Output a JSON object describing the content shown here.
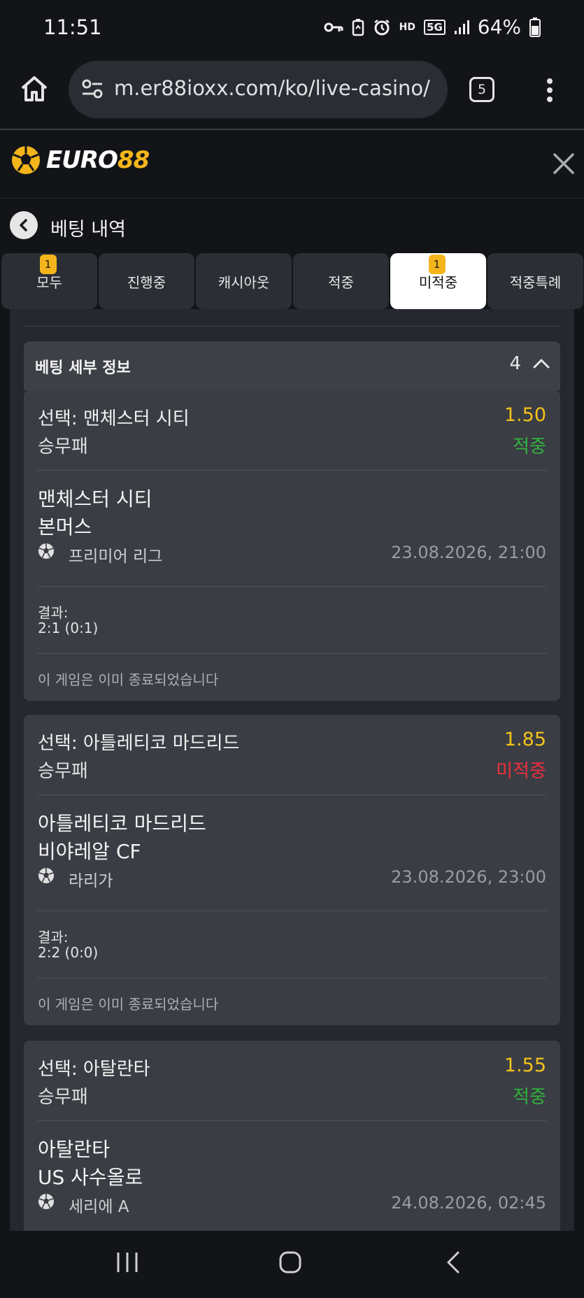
{
  "status_bar": {
    "time": "11:51",
    "network": "HD",
    "network_gen": "5G",
    "battery": "64%"
  },
  "browser": {
    "url": "m.er88ioxx.com/ko/live-casino/",
    "tab_count": "5"
  },
  "site": {
    "brand": "EURO",
    "brand_num": "88"
  },
  "page": {
    "title": "베팅 내역"
  },
  "tabs": [
    {
      "label": "모두",
      "badge": "1"
    },
    {
      "label": "진행중",
      "badge": ""
    },
    {
      "label": "캐시아웃",
      "badge": ""
    },
    {
      "label": "적중",
      "badge": ""
    },
    {
      "label": "미적중",
      "badge": "1",
      "active": true
    },
    {
      "label": "적중특례",
      "badge": ""
    }
  ],
  "details": {
    "header": "베팅 세부 정보",
    "count": "4"
  },
  "bets": [
    {
      "selection": "선택: 맨체스터 시티",
      "market": "승무패",
      "odds": "1.50",
      "status": "적중",
      "home": "맨체스터 시티",
      "away": "본머스",
      "league": "프리미어 리그",
      "date": "23.08.2026, 21:00",
      "result_label": "결과:",
      "result": "2:1 (0:1)",
      "ended": "이 게임은 이미 종료되었습니다"
    },
    {
      "selection": "선택: 아틀레티코 마드리드",
      "market": "승무패",
      "odds": "1.85",
      "status": "미적중",
      "home": "아틀레티코 마드리드",
      "away": "비야레알 CF",
      "league": "라리가",
      "date": "23.08.2026, 23:00",
      "result_label": "결과:",
      "result": "2:2 (0:0)",
      "ended": "이 게임은 이미 종료되었습니다"
    },
    {
      "selection": "선택: 아탈란타",
      "market": "승무패",
      "odds": "1.55",
      "status": "적중",
      "home": "아탈란타",
      "away": "US 사수올로",
      "league": "세리에 A",
      "date": "24.08.2026, 02:45"
    }
  ],
  "colors": {
    "accent": "#f3b51b",
    "odds": "#f3c21b",
    "won": "#31b23b",
    "lost": "#ee2e3d"
  }
}
